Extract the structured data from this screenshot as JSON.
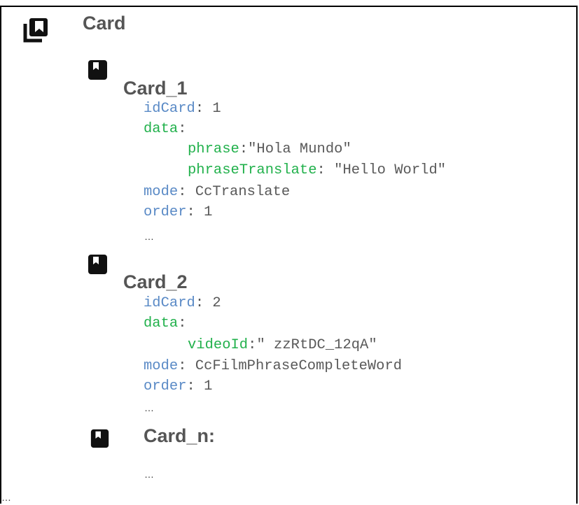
{
  "header": {
    "title": "Card",
    "icon": "stacked-cards-icon"
  },
  "cards": [
    {
      "title": "Card_1",
      "icon": "bookmark-card-icon",
      "fields": {
        "idCard_key": "idCard",
        "idCard_val": " 1",
        "data_key": "data",
        "phrase_key": "phrase",
        "phrase_val": "\"Hola Mundo\"",
        "phraseTranslate_key": "phraseTranslate",
        "phraseTranslate_val": " \"Hello World\"",
        "mode_key": "mode",
        "mode_val": " CcTranslate",
        "order_key": "order",
        "order_val": " 1"
      }
    },
    {
      "title": "Card_2",
      "icon": "bookmark-card-icon",
      "fields": {
        "idCard_key": "idCard",
        "idCard_val": " 2",
        "data_key": "data",
        "videoId_key": "videoId",
        "videoId_val": "\" zzRtDC_12qA\"",
        "mode_key": "mode",
        "mode_val": " CcFilmPhraseCompleteWord",
        "order_key": "order",
        "order_val": " 1"
      }
    },
    {
      "title": "Card_n:",
      "icon": "bookmark-card-icon"
    }
  ],
  "ellipsis": "…",
  "colors": {
    "key_blue": "#5a8ac6",
    "key_green": "#22b14c",
    "text": "#595959",
    "title": "#555555"
  }
}
